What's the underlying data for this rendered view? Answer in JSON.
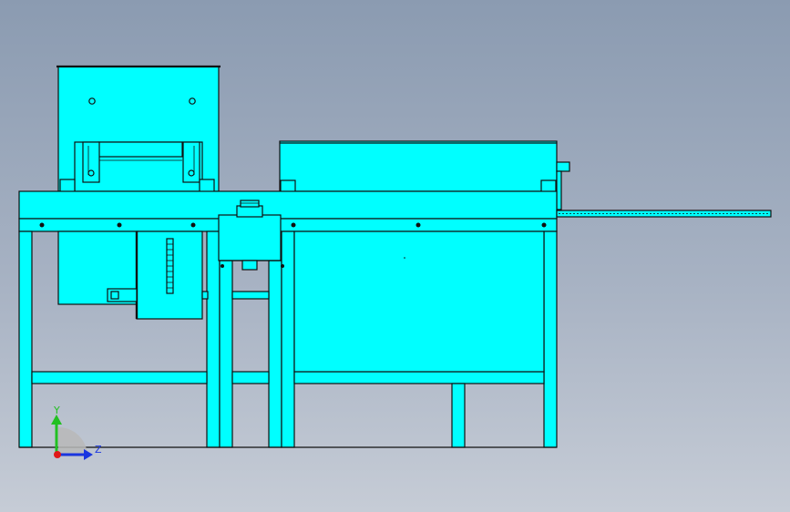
{
  "viewport": {
    "background_top": "#8b9bb1",
    "background_bottom": "#c6ccd6",
    "part_color": "#00ffff",
    "edge_color": "#101010"
  },
  "triad": {
    "y_label": "Y",
    "z_label": "Z",
    "y_color": "#22c022",
    "z_color": "#1a36e0",
    "x_color": "#e01818"
  }
}
